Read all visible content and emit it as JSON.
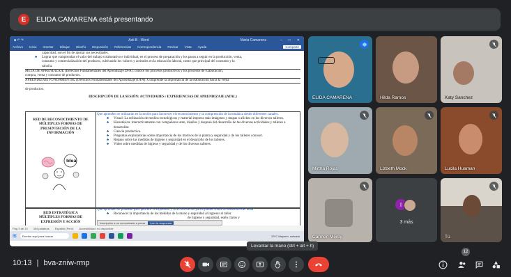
{
  "banner": {
    "initial": "E",
    "text": "ELIDA CAMARENA está presentando"
  },
  "word": {
    "title": "Acti B - Word",
    "account": "Maria Camarena",
    "ribbon_tabs": [
      "Archivo",
      "Inicio",
      "Insertar",
      "Dibujar",
      "Diseño",
      "Disposición",
      "Referencias",
      "Correspondencia",
      "Revisar",
      "Vista",
      "Ayuda"
    ],
    "share": "Compartir",
    "intro_lines": [
      "capacidad; son el fin de ajustar sus necesidades.",
      "Lograr que comprendan el valor del trabajo colaborativo e individual, en el proceso de preparación y los pasos a seguir en la producción, venta,",
      "consumo y comercialización del producto, cultivando los valores y actitudes en la educación laboral, como que principal del consumo y la",
      "salud/a."
    ],
    "meta_line": "META DE APRENDIZAJE (Derechos Fundamentales del Aprendizaje DFA): conoce los procesos productivos y los procesos de Elaboración,",
    "meta_line2": "compra, venta y consumo de productos.",
    "aprendizaje_line": "APRENDIZAJE FUNDAMENTAL (Derechos Fundamentales del Aprendizaje) DFA): Comprende la importancia de la elaboración hacia la venta",
    "aprendizaje_line2": "de productos.",
    "section_header": "DESCRIPCIÓN DE LA SESIÓN: ACTIVIDADES / EXPERIENCIAS DE APRENDIZAJE (ATAL)",
    "red1_title": "RED DE RECONOCIMIENTO DE MÚLTIPLES FORMAS DE PRESENTACIÓN DE LA INFORMACIÓN",
    "red1_intro": "Que aprenden se utilizarán en la sesión para favorecer el reconocimiento y la comprensión de la temática desde diferentes canales.",
    "red1_bullets": [
      "Visual: La utilización de medios tecnológicos y material impreso más imágenes y mapas o afiches en los diversos talleres.",
      "Kinestésica: interactivamente con compañeros ante, diseños y después del desarrollo de las diversas actividades y talleres a desarrollar.",
      "Ciencia productiva.",
      "Preguntas exploratorias sobre importancia de los motivos de la planta y seguridad y de los talleres conocer.",
      "Repaso sobre las medidas de higiene y seguridad en el desarrollo de los talleres.",
      "Video sobre medidas de higiene y seguridad y de los diversos talleres."
    ],
    "idea_label": "Idea",
    "red2_title": "RED ESTRATÉGICA MÚLTIPLES FORMAS DE EXPRESIÓN Y ACCIÓN",
    "red2_intro": "Que aprenden se plantean para permitir la expresión y la acción de los participantes frente al desarrollo del tema.",
    "red2_bullets": [
      "Reconocer la importancia de los medidas de la mano y seguridad al ingresar al taller.",
      "de higiene y seguridad, estén claros y"
    ],
    "notif_text": "Inscripción a un comunicado a pesar",
    "notif_btn": "Leer la respuesta",
    "status_items": [
      "Pág 3 de 10",
      "354 palabras",
      "Español (Perú)",
      "Accesibilidad: no disponible"
    ],
    "search_placeholder": "Escribe aquí para buscar",
    "sys_text": "29°C  Mayorm. soleado"
  },
  "participants": [
    {
      "name": "ELIDA CAMARENA",
      "speaking": true
    },
    {
      "name": "Hilda Ramos",
      "speaking": false
    },
    {
      "name": "Katy Sanchez",
      "speaking": false
    },
    {
      "name": "Mirtha Rojas",
      "speaking": false
    },
    {
      "name": "Lizbeth Mock",
      "speaking": false
    },
    {
      "name": "Lucila Huaman",
      "speaking": false
    },
    {
      "name": "Carmen Mercy",
      "speaking": false
    },
    {
      "name": "3 más",
      "speaking": false
    },
    {
      "name": "Tú",
      "speaking": false
    }
  ],
  "more_initial": "I",
  "control_bar": {
    "time": "10:13",
    "separator": "|",
    "meeting_code": "bva-zniw-rmp",
    "tooltip": "Levantar la mano (ctrl + alt + h)",
    "participant_count": "12"
  },
  "colors": {
    "bg": "#202124",
    "accent_red": "#ea4335",
    "word_blue": "#2b579a",
    "speaking_blue": "#1a73e8"
  }
}
